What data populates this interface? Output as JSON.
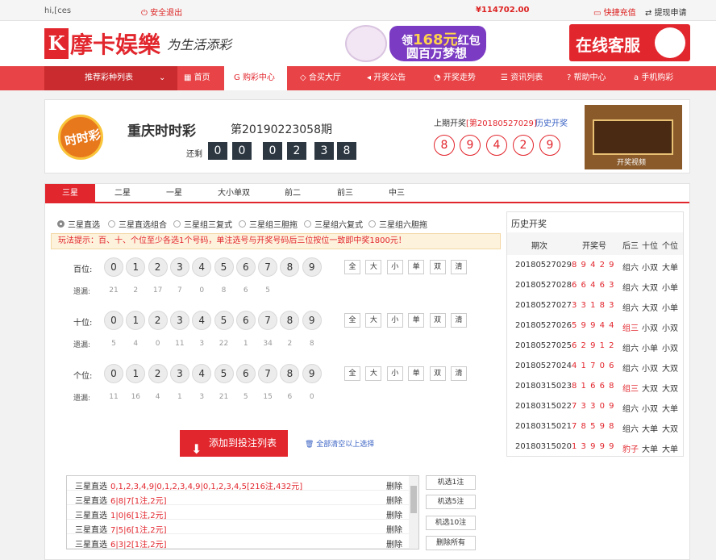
{
  "topbar": {
    "greeting": "hi,[ces",
    "logout": "安全退出",
    "balance": "¥114702.00",
    "quick_recharge": "快捷充值",
    "withdraw": "提现申请"
  },
  "header": {
    "logo_letter": "K",
    "logo_text": "摩卡娱樂",
    "slogan": "为生活添彩",
    "promo_line1_prefix": "领",
    "promo_amount": "168元",
    "promo_line1_suffix": "红包",
    "promo_line2": "圆百万梦想",
    "service": "在线客服"
  },
  "nav": {
    "recommend": "推荐彩种列表",
    "items": [
      "首页",
      "购彩中心",
      "合买大厅",
      "开奖公告",
      "开奖走势",
      "资讯列表",
      "帮助中心",
      "手机购彩"
    ]
  },
  "lottery": {
    "logo_text": "时时彩",
    "name": "重庆时时彩",
    "issue": "第20190223058期",
    "remain_label": "还剩",
    "countdown": [
      "0",
      "0",
      "0",
      "2",
      "3",
      "8"
    ],
    "prev_label": "上期开奖",
    "prev_issue": "[第20180527029]",
    "history_link": "历史开奖",
    "prev_balls": [
      "8",
      "9",
      "4",
      "2",
      "9"
    ],
    "video_label": "开奖视频"
  },
  "tabs": [
    "三星",
    "二星",
    "一星",
    "大小单双",
    "前二",
    "前三",
    "中三"
  ],
  "play_types": [
    "三星直选",
    "三星直选组合",
    "三星组三复式",
    "三星组三胆拖",
    "三星组六复式",
    "三星组六胆拖"
  ],
  "hint": "玩法提示：百、十、个位至少各选1个号码，单注选号与开奖号码后三位按位一致即中奖1800元！",
  "picker": {
    "numbers": [
      "0",
      "1",
      "2",
      "3",
      "4",
      "5",
      "6",
      "7",
      "8",
      "9"
    ],
    "quick": [
      "全",
      "大",
      "小",
      "单",
      "双",
      "清"
    ],
    "miss_label": "遗漏:",
    "rows": [
      {
        "label": "百位:",
        "miss": [
          "21",
          "2",
          "17",
          "7",
          "0",
          "8",
          "6",
          "5"
        ]
      },
      {
        "label": "十位:",
        "miss": [
          "5",
          "4",
          "0",
          "11",
          "3",
          "22",
          "1",
          "34",
          "2",
          "8"
        ]
      },
      {
        "label": "个位:",
        "miss": [
          "11",
          "16",
          "4",
          "1",
          "3",
          "21",
          "5",
          "15",
          "6",
          "0"
        ]
      }
    ]
  },
  "actions": {
    "add": "添加到投注列表",
    "clear": "全部清空以上选择"
  },
  "history": {
    "title": "历史开奖",
    "headers": [
      "期次",
      "开奖号",
      "后三",
      "十位",
      "个位"
    ],
    "rows": [
      {
        "issue": "20180527029",
        "nums": "8 9 4 2 9",
        "h3": "组六",
        "ten": "小双",
        "one": "大单",
        "hot": false
      },
      {
        "issue": "20180527028",
        "nums": "6 6 4 6 3",
        "h3": "组六",
        "ten": "大双",
        "one": "小单",
        "hot": false
      },
      {
        "issue": "20180527027",
        "nums": "3 3 1 8 3",
        "h3": "组六",
        "ten": "大双",
        "one": "小单",
        "hot": false
      },
      {
        "issue": "20180527026",
        "nums": "5 9 9 4 4",
        "h3": "组三",
        "ten": "小双",
        "one": "小双",
        "hot": true
      },
      {
        "issue": "20180527025",
        "nums": "6 2 9 1 2",
        "h3": "组六",
        "ten": "小单",
        "one": "小双",
        "hot": false
      },
      {
        "issue": "20180527024",
        "nums": "4 1 7 0 6",
        "h3": "组六",
        "ten": "小双",
        "one": "大双",
        "hot": false
      },
      {
        "issue": "20180315023",
        "nums": "8 1 6 6 8",
        "h3": "组三",
        "ten": "大双",
        "one": "大双",
        "hot": true
      },
      {
        "issue": "20180315022",
        "nums": "7 3 3 0 9",
        "h3": "组六",
        "ten": "小双",
        "one": "大单",
        "hot": false
      },
      {
        "issue": "20180315021",
        "nums": "7 8 5 9 8",
        "h3": "组六",
        "ten": "大单",
        "one": "大双",
        "hot": false
      },
      {
        "issue": "20180315020",
        "nums": "1 3 9 9 9",
        "h3": "豹子",
        "ten": "大单",
        "one": "大单",
        "hot": true
      }
    ]
  },
  "bets": [
    {
      "type": "三星直选",
      "detail": "0,1,2,3,4,9|0,1,2,3,4,9|0,1,2,3,4,5[216注,432元]",
      "del": "删除"
    },
    {
      "type": "三星直选",
      "detail": "6|8|7[1注,2元]",
      "del": "删除"
    },
    {
      "type": "三星直选",
      "detail": "1|0|6[1注,2元]",
      "del": "删除"
    },
    {
      "type": "三星直选",
      "detail": "7|5|6[1注,2元]",
      "del": "删除"
    },
    {
      "type": "三星直选",
      "detail": "6|3|2[1注,2元]",
      "del": "删除"
    }
  ],
  "bet_actions": [
    "机选1注",
    "机选5注",
    "机选10注",
    "删除所有"
  ],
  "colors": {
    "brand": "#e2262d",
    "nav": "#e84346",
    "link": "#3a62c4"
  }
}
